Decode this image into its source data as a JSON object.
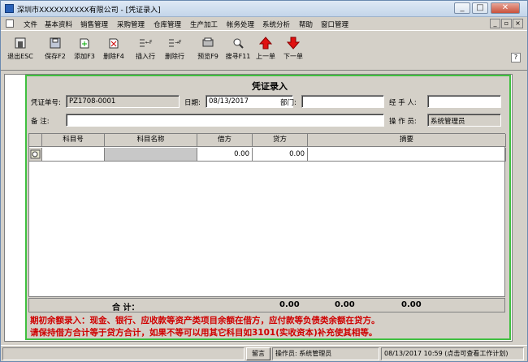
{
  "window": {
    "title": "深圳市XXXXXXXXXX有限公司 - [凭证录入]"
  },
  "menu": [
    "文件",
    "基本资料",
    "销售管理",
    "采购管理",
    "仓库管理",
    "生产加工",
    "帐务处理",
    "系统分析",
    "帮助",
    "窗口管理"
  ],
  "toolbar": [
    {
      "label": "退出ESC",
      "icon": "exit-icon"
    },
    {
      "label": "保存F2",
      "icon": "save-icon"
    },
    {
      "label": "添加F3",
      "icon": "add-icon"
    },
    {
      "label": "删除F4",
      "icon": "delete-icon"
    },
    {
      "label": "插入行",
      "icon": "insert-row-icon",
      "hotkey": "F6"
    },
    {
      "label": "删除行",
      "icon": "delete-row-icon",
      "hotkey": "F7"
    },
    {
      "label": "预览F9",
      "icon": "preview-icon"
    },
    {
      "label": "搜寻F11",
      "icon": "search-icon"
    },
    {
      "label": "上一单",
      "icon": "arrow-up-icon"
    },
    {
      "label": "下一单",
      "icon": "arrow-down-icon"
    }
  ],
  "form": {
    "title": "凭证录入",
    "voucher_no_label": "凭证单号:",
    "voucher_no": "PZ1708-0001",
    "date_label": "日期:",
    "date": "08/13/2017",
    "dept_label": "部门:",
    "dept": "",
    "handler_label": "经 手 人:",
    "handler": "",
    "remark_label": "备   注:",
    "remark": "",
    "operator_label": "操 作 员:",
    "operator": "系统管理员"
  },
  "grid": {
    "columns": [
      "科目号",
      "科目名称",
      "借方",
      "贷方",
      "摘要"
    ],
    "rows": [
      {
        "code": "",
        "name": "",
        "debit": "0.00",
        "credit": "0.00",
        "summary": ""
      }
    ]
  },
  "totals": {
    "label": "合 计：",
    "debit": "0.00",
    "credit": "0.00",
    "other": "0.00"
  },
  "notes": [
    "期初余额录入：现金、银行、应收款等资产类项目余额在借方，应付款等负债类余额在贷方。",
    "请保持借方合计等于贷方合计，如果不等可以用其它科目如3101(实收资本)补充使其相等。"
  ],
  "statusbar": {
    "leave_msg": "留言",
    "operator": "操作员: 系统管理员",
    "datetime": "08/13/2017 10:59 (点击可查看工作计划)"
  }
}
